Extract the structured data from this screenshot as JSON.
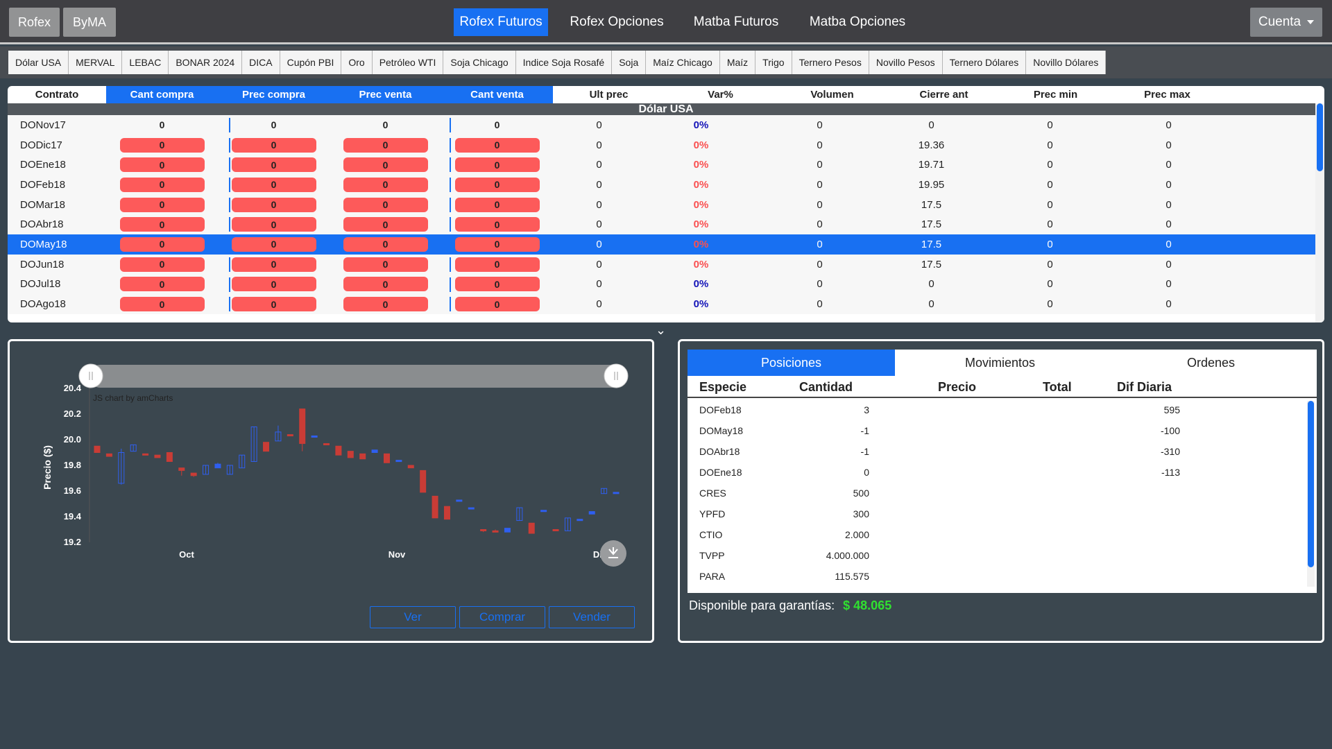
{
  "topbar": {
    "exchange_buttons": [
      "Rofex",
      "ByMA"
    ],
    "nav": [
      {
        "label": "Rofex Futuros",
        "active": true
      },
      {
        "label": "Rofex Opciones",
        "active": false
      },
      {
        "label": "Matba Futuros",
        "active": false
      },
      {
        "label": "Matba Opciones",
        "active": false
      }
    ],
    "account_label": "Cuenta"
  },
  "instruments": [
    "Dólar USA",
    "MERVAL",
    "LEBAC",
    "BONAR 2024",
    "DICA",
    "Cupón PBI",
    "Oro",
    "Petróleo WTI",
    "Soja Chicago",
    "Indice Soja Rosafé",
    "Soja",
    "Maíz Chicago",
    "Maíz",
    "Trigo",
    "Ternero Pesos",
    "Novillo Pesos",
    "Ternero Dólares",
    "Novillo Dólares"
  ],
  "market": {
    "columns": [
      "Contrato",
      "Cant compra",
      "Prec compra",
      "Prec venta",
      "Cant venta",
      "Ult prec",
      "Var%",
      "Volumen",
      "Cierre ant",
      "Prec min",
      "Prec max"
    ],
    "group_title": "Dólar USA",
    "rows": [
      {
        "contrato": "DONov17",
        "cant_compra": "0",
        "prec_compra": "0",
        "prec_venta": "0",
        "cant_venta": "0",
        "ult": "0",
        "var": "0%",
        "vol": "0",
        "cierre": "0",
        "min": "0",
        "max": "0",
        "pills": false,
        "var_red": false,
        "selected": false
      },
      {
        "contrato": "DODic17",
        "cant_compra": "0",
        "prec_compra": "0",
        "prec_venta": "0",
        "cant_venta": "0",
        "ult": "0",
        "var": "0%",
        "vol": "0",
        "cierre": "19.36",
        "min": "0",
        "max": "0",
        "pills": true,
        "var_red": true,
        "selected": false
      },
      {
        "contrato": "DOEne18",
        "cant_compra": "0",
        "prec_compra": "0",
        "prec_venta": "0",
        "cant_venta": "0",
        "ult": "0",
        "var": "0%",
        "vol": "0",
        "cierre": "19.71",
        "min": "0",
        "max": "0",
        "pills": true,
        "var_red": true,
        "selected": false
      },
      {
        "contrato": "DOFeb18",
        "cant_compra": "0",
        "prec_compra": "0",
        "prec_venta": "0",
        "cant_venta": "0",
        "ult": "0",
        "var": "0%",
        "vol": "0",
        "cierre": "19.95",
        "min": "0",
        "max": "0",
        "pills": true,
        "var_red": true,
        "selected": false
      },
      {
        "contrato": "DOMar18",
        "cant_compra": "0",
        "prec_compra": "0",
        "prec_venta": "0",
        "cant_venta": "0",
        "ult": "0",
        "var": "0%",
        "vol": "0",
        "cierre": "17.5",
        "min": "0",
        "max": "0",
        "pills": true,
        "var_red": true,
        "selected": false
      },
      {
        "contrato": "DOAbr18",
        "cant_compra": "0",
        "prec_compra": "0",
        "prec_venta": "0",
        "cant_venta": "0",
        "ult": "0",
        "var": "0%",
        "vol": "0",
        "cierre": "17.5",
        "min": "0",
        "max": "0",
        "pills": true,
        "var_red": true,
        "selected": false
      },
      {
        "contrato": "DOMay18",
        "cant_compra": "0",
        "prec_compra": "0",
        "prec_venta": "0",
        "cant_venta": "0",
        "ult": "0",
        "var": "0%",
        "vol": "0",
        "cierre": "17.5",
        "min": "0",
        "max": "0",
        "pills": true,
        "var_red": true,
        "selected": true
      },
      {
        "contrato": "DOJun18",
        "cant_compra": "0",
        "prec_compra": "0",
        "prec_venta": "0",
        "cant_venta": "0",
        "ult": "0",
        "var": "0%",
        "vol": "0",
        "cierre": "17.5",
        "min": "0",
        "max": "0",
        "pills": true,
        "var_red": true,
        "selected": false
      },
      {
        "contrato": "DOJul18",
        "cant_compra": "0",
        "prec_compra": "0",
        "prec_venta": "0",
        "cant_venta": "0",
        "ult": "0",
        "var": "0%",
        "vol": "0",
        "cierre": "0",
        "min": "0",
        "max": "0",
        "pills": true,
        "var_red": false,
        "selected": false
      },
      {
        "contrato": "DOAgo18",
        "cant_compra": "0",
        "prec_compra": "0",
        "prec_venta": "0",
        "cant_venta": "0",
        "ult": "0",
        "var": "0%",
        "vol": "0",
        "cierre": "0",
        "min": "0",
        "max": "0",
        "pills": true,
        "var_red": false,
        "selected": false
      }
    ]
  },
  "chart_panel": {
    "credit": "JS chart by amCharts",
    "buttons": [
      "Ver",
      "Comprar",
      "Vender"
    ]
  },
  "chart_data": {
    "type": "candlestick",
    "ylabel": "Precio ($)",
    "ylim": [
      19.2,
      20.4
    ],
    "yticks": [
      19.2,
      19.4,
      19.6,
      19.8,
      20.0,
      20.2,
      20.4
    ],
    "xticks": [
      "Oct",
      "Nov",
      "Dic"
    ],
    "up_color": "#2f5ff0",
    "down_color": "#c93c36",
    "candles": [
      {
        "open": 19.95,
        "close": 19.9,
        "high": 19.95,
        "low": 19.9
      },
      {
        "open": 19.89,
        "close": 19.87,
        "high": 19.89,
        "low": 19.87
      },
      {
        "open": 19.66,
        "close": 19.9,
        "high": 19.93,
        "low": 19.65
      },
      {
        "open": 19.91,
        "close": 19.96,
        "high": 19.96,
        "low": 19.91
      },
      {
        "open": 19.89,
        "close": 19.88,
        "high": 19.89,
        "low": 19.88
      },
      {
        "open": 19.88,
        "close": 19.86,
        "high": 19.88,
        "low": 19.86
      },
      {
        "open": 19.9,
        "close": 19.83,
        "high": 19.9,
        "low": 19.83
      },
      {
        "open": 19.78,
        "close": 19.76,
        "high": 19.78,
        "low": 19.72
      },
      {
        "open": 19.74,
        "close": 19.72,
        "high": 19.74,
        "low": 19.71
      },
      {
        "open": 19.73,
        "close": 19.8,
        "high": 19.8,
        "low": 19.73
      },
      {
        "open": 19.78,
        "close": 19.81,
        "high": 19.82,
        "low": 19.78
      },
      {
        "open": 19.73,
        "close": 19.8,
        "high": 19.8,
        "low": 19.73
      },
      {
        "open": 19.78,
        "close": 19.88,
        "high": 19.88,
        "low": 19.78
      },
      {
        "open": 19.83,
        "close": 20.1,
        "high": 20.1,
        "low": 19.83
      },
      {
        "open": 19.98,
        "close": 19.91,
        "high": 19.98,
        "low": 19.91
      },
      {
        "open": 19.99,
        "close": 20.06,
        "high": 20.11,
        "low": 19.99
      },
      {
        "open": 20.04,
        "close": 20.03,
        "high": 20.04,
        "low": 20.03
      },
      {
        "open": 20.24,
        "close": 19.97,
        "high": 20.24,
        "low": 19.91
      },
      {
        "open": 20.02,
        "close": 20.03,
        "high": 20.03,
        "low": 20.02
      },
      {
        "open": 19.97,
        "close": 19.96,
        "high": 19.97,
        "low": 19.96
      },
      {
        "open": 19.95,
        "close": 19.88,
        "high": 19.95,
        "low": 19.88
      },
      {
        "open": 19.91,
        "close": 19.86,
        "high": 19.91,
        "low": 19.86
      },
      {
        "open": 19.89,
        "close": 19.85,
        "high": 19.89,
        "low": 19.85
      },
      {
        "open": 19.9,
        "close": 19.92,
        "high": 19.92,
        "low": 19.9
      },
      {
        "open": 19.89,
        "close": 19.82,
        "high": 19.89,
        "low": 19.82
      },
      {
        "open": 19.84,
        "close": 19.84,
        "high": 19.84,
        "low": 19.84
      },
      {
        "open": 19.8,
        "close": 19.78,
        "high": 19.8,
        "low": 19.78
      },
      {
        "open": 19.76,
        "close": 19.59,
        "high": 19.76,
        "low": 19.59
      },
      {
        "open": 19.56,
        "close": 19.39,
        "high": 19.56,
        "low": 19.39
      },
      {
        "open": 19.48,
        "close": 19.38,
        "high": 19.48,
        "low": 19.38
      },
      {
        "open": 19.52,
        "close": 19.53,
        "high": 19.53,
        "low": 19.52
      },
      {
        "open": 19.47,
        "close": 19.47,
        "high": 19.47,
        "low": 19.47
      },
      {
        "open": 19.3,
        "close": 19.29,
        "high": 19.3,
        "low": 19.28
      },
      {
        "open": 19.29,
        "close": 19.28,
        "high": 19.3,
        "low": 19.28
      },
      {
        "open": 19.28,
        "close": 19.31,
        "high": 19.31,
        "low": 19.28
      },
      {
        "open": 19.37,
        "close": 19.47,
        "high": 19.47,
        "low": 19.37
      },
      {
        "open": 19.35,
        "close": 19.27,
        "high": 19.35,
        "low": 19.27
      },
      {
        "open": 19.45,
        "close": 19.45,
        "high": 19.45,
        "low": 19.45
      },
      {
        "open": 19.3,
        "close": 19.29,
        "high": 19.3,
        "low": 19.29
      },
      {
        "open": 19.29,
        "close": 19.39,
        "high": 19.39,
        "low": 19.29
      },
      {
        "open": 19.38,
        "close": 19.38,
        "high": 19.38,
        "low": 19.38
      },
      {
        "open": 19.42,
        "close": 19.44,
        "high": 19.44,
        "low": 19.42
      },
      {
        "open": 19.58,
        "close": 19.62,
        "high": 19.62,
        "low": 19.58
      },
      {
        "open": 19.58,
        "close": 19.59,
        "high": 19.59,
        "low": 19.58
      }
    ]
  },
  "positions": {
    "tabs": [
      {
        "label": "Posiciones",
        "active": true
      },
      {
        "label": "Movimientos",
        "active": false
      },
      {
        "label": "Ordenes",
        "active": false
      }
    ],
    "columns": [
      "Especie",
      "Cantidad",
      "Precio",
      "Total",
      "Dif Diaria"
    ],
    "rows": [
      {
        "especie": "DOFeb18",
        "cantidad": "3",
        "precio": "",
        "total": "",
        "dif": "595"
      },
      {
        "especie": "DOMay18",
        "cantidad": "-1",
        "precio": "",
        "total": "",
        "dif": "-100"
      },
      {
        "especie": "DOAbr18",
        "cantidad": "-1",
        "precio": "",
        "total": "",
        "dif": "-310"
      },
      {
        "especie": "DOEne18",
        "cantidad": "0",
        "precio": "",
        "total": "",
        "dif": "-113"
      },
      {
        "especie": "CRES",
        "cantidad": "500",
        "precio": "",
        "total": "",
        "dif": ""
      },
      {
        "especie": "YPFD",
        "cantidad": "300",
        "precio": "",
        "total": "",
        "dif": ""
      },
      {
        "especie": "CTIO",
        "cantidad": "2.000",
        "precio": "",
        "total": "",
        "dif": ""
      },
      {
        "especie": "TVPP",
        "cantidad": "4.000.000",
        "precio": "",
        "total": "",
        "dif": ""
      },
      {
        "especie": "PARA",
        "cantidad": "115.575",
        "precio": "",
        "total": "",
        "dif": ""
      }
    ],
    "guarantee_label": "Disponible para garantías:",
    "guarantee_amount": "$ 48.065"
  }
}
